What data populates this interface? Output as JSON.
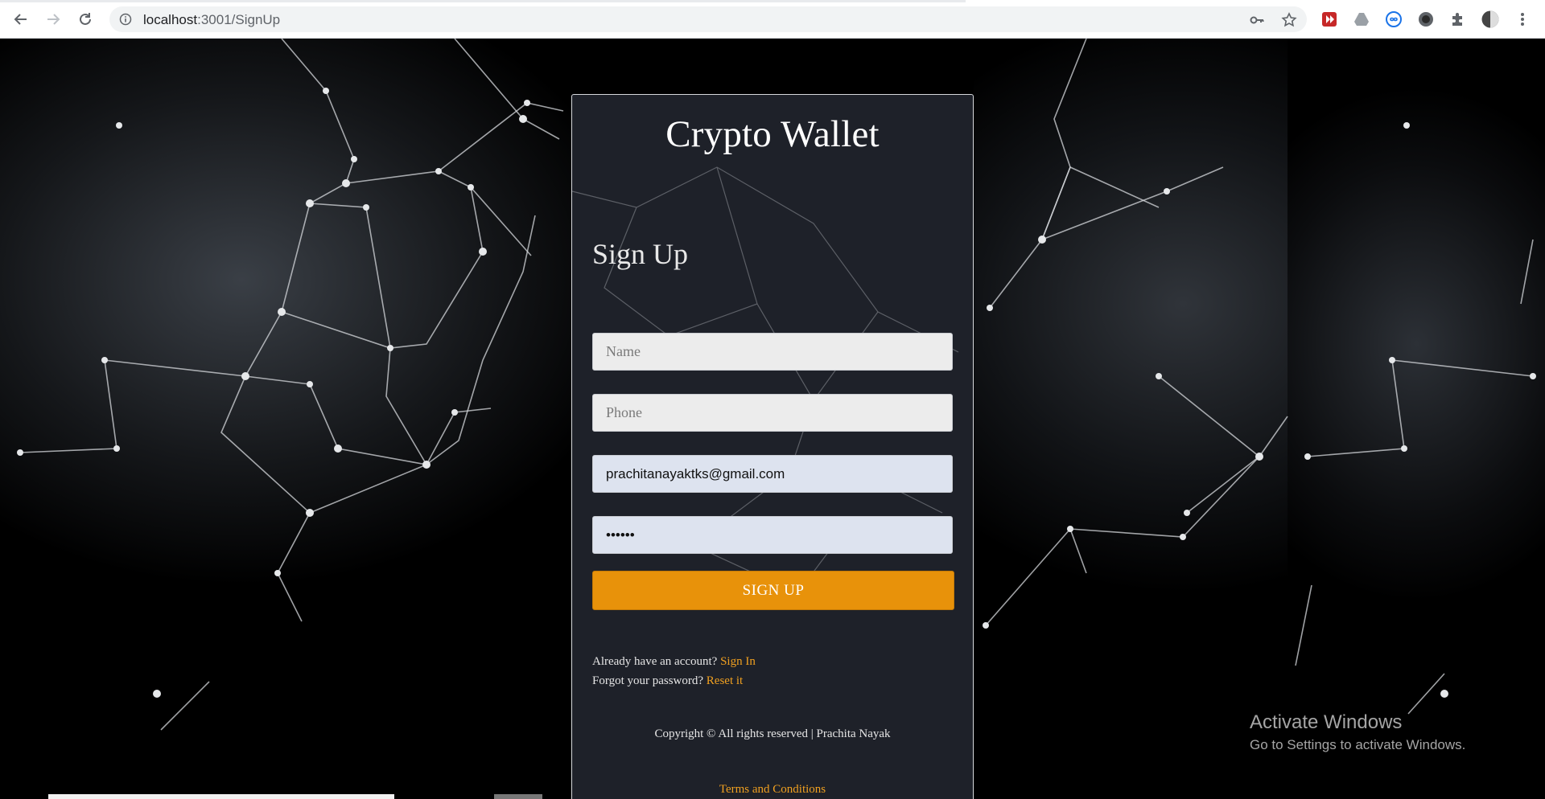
{
  "browser": {
    "url_host": "localhost",
    "url_path": ":3001/SignUp"
  },
  "page": {
    "brand": "Crypto Wallet",
    "heading": "Sign Up"
  },
  "form": {
    "name_placeholder": "Name",
    "phone_placeholder": "Phone",
    "email_value": "prachitanayaktks@gmail.com",
    "password_value": "••••••",
    "signup_label": "SIGN UP"
  },
  "links": {
    "account_text": "Already have an account?",
    "signin_label": "Sign In",
    "forgot_text": "Forgot your password?",
    "reset_label": "Reset it"
  },
  "footer": {
    "copyright": "Copyright © All rights reserved | Prachita Nayak",
    "terms": "Terms and Conditions"
  },
  "windows_watermark": {
    "title": "Activate Windows",
    "subtitle": "Go to Settings to activate Windows."
  },
  "colors": {
    "accent": "#e8920a",
    "link": "#f0a020",
    "card_bg": "#20242c"
  }
}
